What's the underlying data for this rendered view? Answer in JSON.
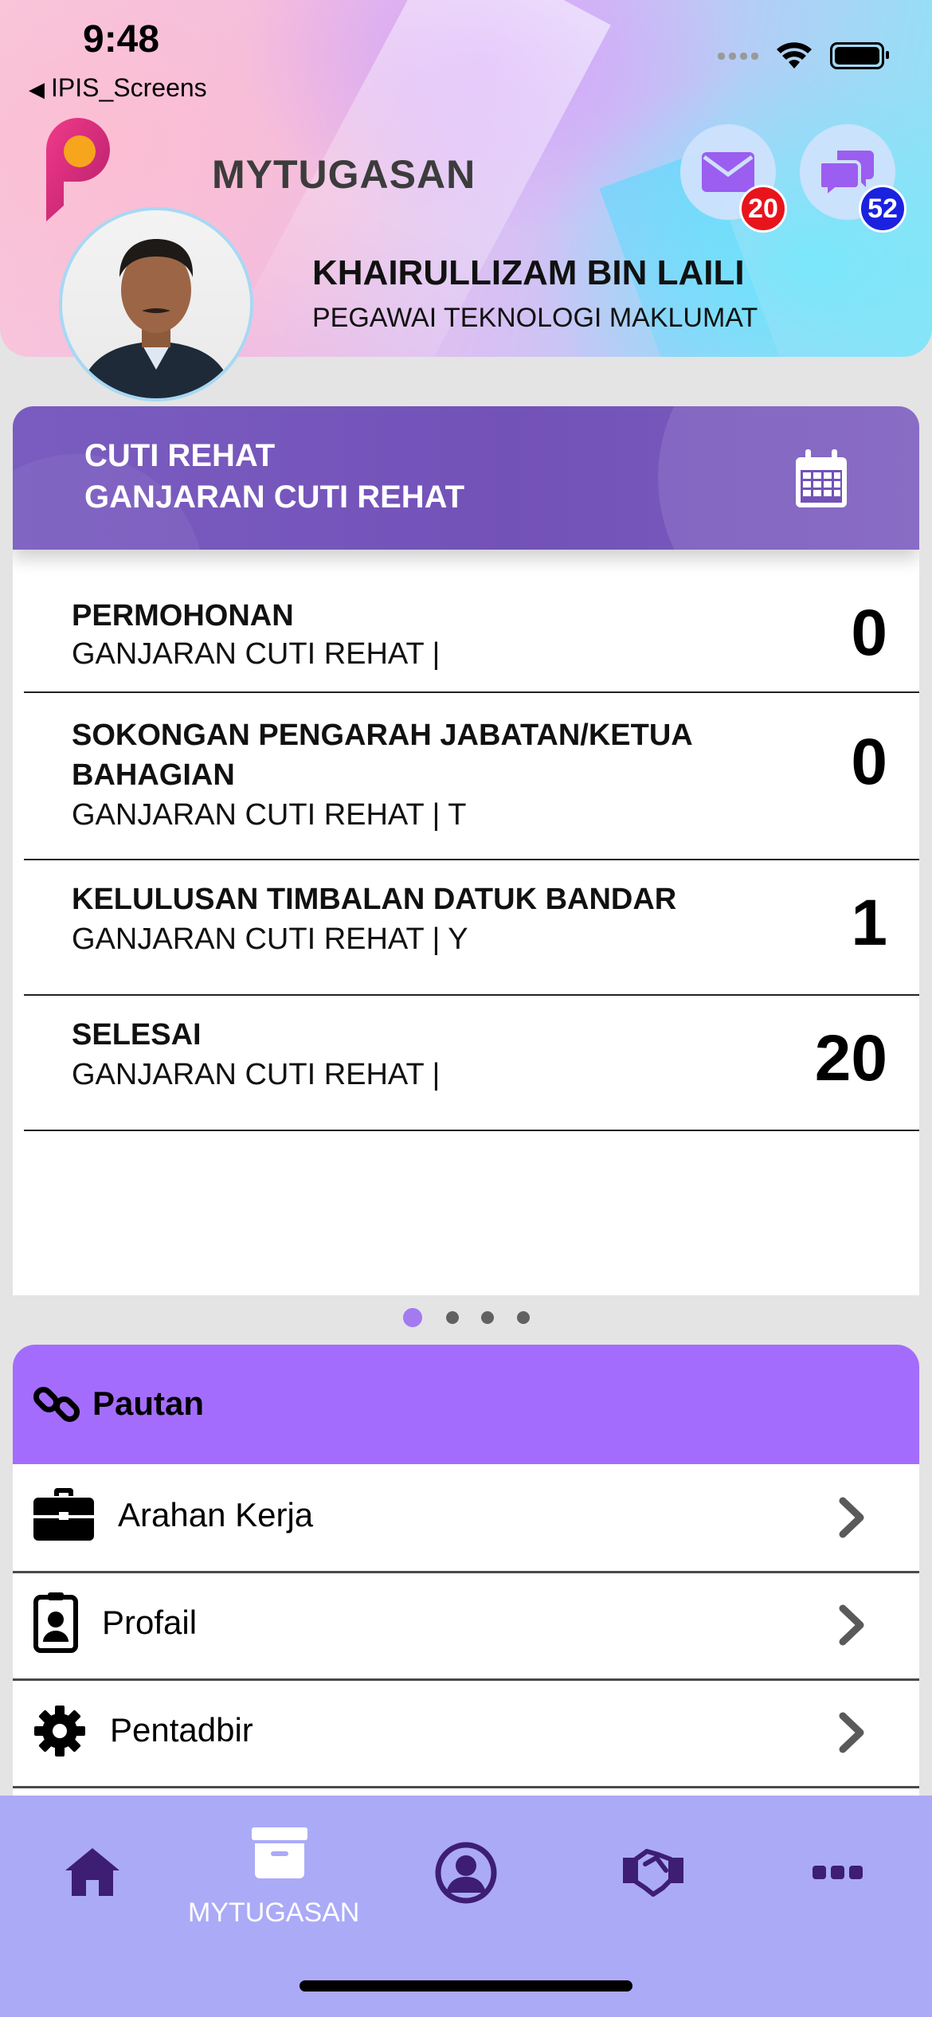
{
  "status_bar": {
    "time": "9:48",
    "back_label": "IPIS_Screens"
  },
  "header": {
    "app_title": "MYTUGASAN",
    "mail_badge": "20",
    "chat_badge": "52",
    "user": {
      "name": "KHAIRULLIZAM BIN LAILI",
      "role": "PEGAWAI TEKNOLOGI MAKLUMAT"
    }
  },
  "leave_card": {
    "title_line1": "CUTI REHAT",
    "title_line2": "GANJARAN CUTI REHAT",
    "icon": "calendar-icon",
    "rows": [
      {
        "title": "PERMOHONAN",
        "subtitle": "GANJARAN CUTI REHAT |",
        "count": "0"
      },
      {
        "title": "SOKONGAN PENGARAH JABATAN/KETUA BAHAGIAN",
        "subtitle": "GANJARAN CUTI REHAT | T",
        "count": "0"
      },
      {
        "title": "KELULUSAN TIMBALAN DATUK BANDAR",
        "subtitle": "GANJARAN CUTI REHAT | Y",
        "count": "1"
      },
      {
        "title": "SELESAI",
        "subtitle": "GANJARAN CUTI REHAT |",
        "count": "20"
      }
    ]
  },
  "pager": {
    "pages": 4,
    "active": 1
  },
  "links": {
    "title": "Pautan",
    "items": [
      {
        "label": "Arahan Kerja",
        "icon": "briefcase-icon"
      },
      {
        "label": "Profail",
        "icon": "id-badge-icon"
      },
      {
        "label": "Pentadbir",
        "icon": "gear-icon"
      }
    ]
  },
  "tabbar": {
    "items": [
      {
        "name": "home",
        "icon": "home-icon"
      },
      {
        "name": "mytugasan",
        "icon": "archive-icon",
        "label": "MYTUGASAN",
        "active": true
      },
      {
        "name": "profile",
        "icon": "user-circle-icon"
      },
      {
        "name": "handshake",
        "icon": "handshake-icon"
      },
      {
        "name": "more",
        "icon": "more-icon"
      }
    ]
  },
  "colors": {
    "card_header": "#7352b8",
    "links_header": "#a46cfc",
    "tabbar": "#abaaf7",
    "mail_badge": "#e8141c",
    "chat_badge": "#1a22e0",
    "pager_active": "#a47af0"
  }
}
